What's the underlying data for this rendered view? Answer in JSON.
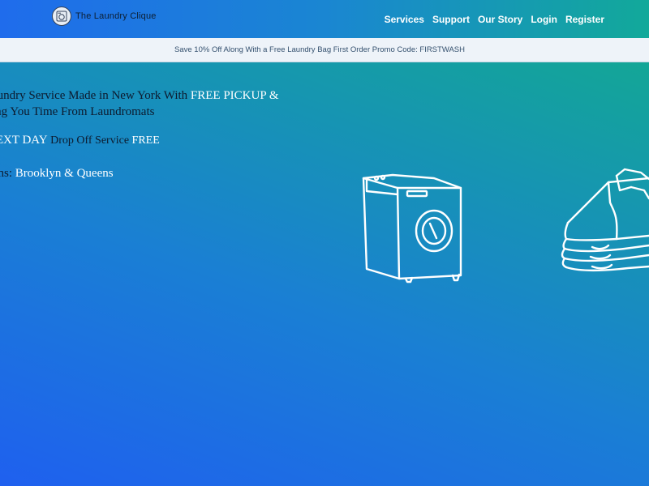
{
  "header": {
    "brand_name": "The Laundry Clique",
    "logo_icon": "washing-machine-logo-icon",
    "nav": [
      {
        "label": "Services"
      },
      {
        "label": "Support"
      },
      {
        "label": "Our Story"
      },
      {
        "label": "Login"
      },
      {
        "label": "Register"
      }
    ]
  },
  "promo": {
    "text": "Save 10% Off Along With a Free Laundry Bag First Order Promo Code: FIRSTWASH"
  },
  "hero": {
    "line1_text": "aundry Service Made in New York With ",
    "line1_highlight": "FREE PICKUP &",
    "line2_text": "ing You Time From Laundromats",
    "line3_highlight1": "NEXT DAY",
    "line3_text": " Drop Off Service ",
    "line3_highlight2": "FREE",
    "line4_text": "ons: ",
    "line4_highlight": "Brooklyn & Queens"
  },
  "illustrations": {
    "icons": [
      "washing-machine-icon",
      "folded-clothes-icon"
    ]
  },
  "colors": {
    "text_dark": "#0d1a2e",
    "highlight": "#ffffff",
    "promo_bg": "#eef3f9"
  }
}
